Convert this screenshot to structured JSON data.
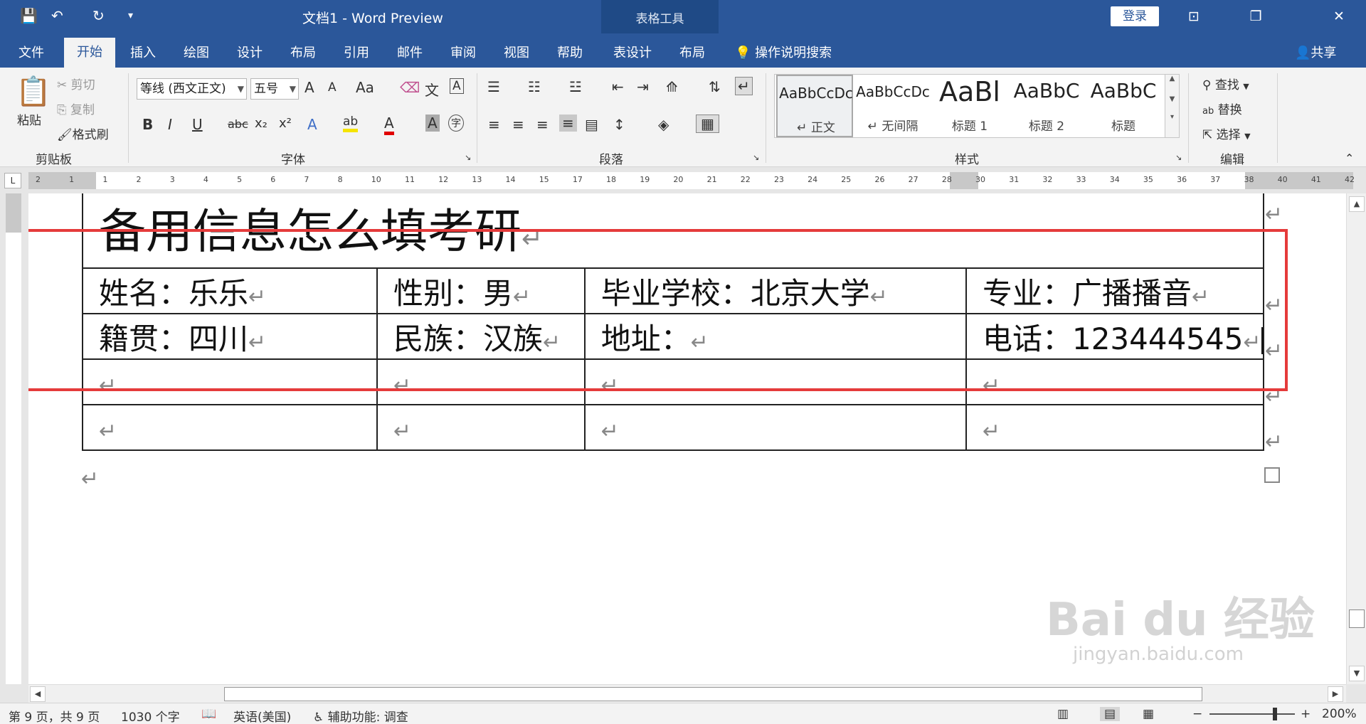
{
  "titlebar": {
    "doc_title": "文档1  -  Word Preview",
    "context_title": "表格工具",
    "login": "登录",
    "qa_save": "💾",
    "qa_undo": "↶",
    "qa_redo": "↻",
    "qa_customize": "▾",
    "btn_restore_ribbon": "⊡",
    "btn_maximize": "❐",
    "btn_close": "✕"
  },
  "tabs": {
    "items": [
      "文件",
      "开始",
      "插入",
      "绘图",
      "设计",
      "布局",
      "引用",
      "邮件",
      "审阅",
      "视图",
      "帮助",
      "表设计",
      "布局"
    ],
    "active": "开始",
    "tell_me": "操作说明搜索",
    "share": "共享"
  },
  "ribbon": {
    "clipboard": {
      "paste": "粘贴",
      "cut": "剪切",
      "copy": "复制",
      "format_painter": "格式刷",
      "label": "剪贴板"
    },
    "font": {
      "font_name": "等线 (西文正文)",
      "font_size": "五号",
      "label": "字体",
      "bold": "B",
      "italic": "I",
      "underline": "U",
      "strike": "abc",
      "subscript": "x₂",
      "superscript": "x²",
      "grow": "A",
      "shrink": "A",
      "change_case": "Aa",
      "phonetic": "文",
      "char_border": "A",
      "effects": "A",
      "highlight": "ab",
      "font_color": "A",
      "char_shade": "A",
      "enclose": "字"
    },
    "paragraph": {
      "label": "段落"
    },
    "styles": {
      "label": "样式",
      "items": [
        {
          "sample": "AaBbCcDc",
          "name": "↵ 正文"
        },
        {
          "sample": "AaBbCcDc",
          "name": "↵ 无间隔"
        },
        {
          "sample": "AaBl",
          "name": "标题 1"
        },
        {
          "sample": "AaBbC",
          "name": "标题 2"
        },
        {
          "sample": "AaBbC",
          "name": "标题"
        }
      ]
    },
    "editing": {
      "label": "编辑",
      "find": "查找",
      "replace": "替换",
      "select": "选择"
    }
  },
  "ruler": {
    "numbers": [
      "2",
      "1",
      "1",
      "2",
      "3",
      "4",
      "5",
      "6",
      "7",
      "8",
      "10",
      "11",
      "12",
      "13",
      "14",
      "15",
      "17",
      "18",
      "19",
      "20",
      "21",
      "22",
      "23",
      "24",
      "25",
      "26",
      "27",
      "28",
      "30",
      "31",
      "32",
      "33",
      "34",
      "35",
      "36",
      "37",
      "38",
      "40",
      "41",
      "42"
    ]
  },
  "document": {
    "title": "备用信息怎么填考研",
    "rows": [
      [
        "姓名：乐乐",
        "性别：男",
        "毕业学校：北京大学",
        "专业：广播播音"
      ],
      [
        "籍贯：四川",
        "民族：汉族",
        "地址：",
        "电话：123444545"
      ],
      [
        "",
        "",
        "",
        ""
      ],
      [
        "",
        "",
        "",
        ""
      ]
    ],
    "mark": "↵"
  },
  "statusbar": {
    "page": "第 9 页，共 9 页",
    "words": "1030 个字",
    "language": "英语(美国)",
    "accessibility": "辅助功能: 调查",
    "zoom": "200%",
    "zoom_fraction": 0.77
  },
  "watermark": {
    "main": "Bai du 经验",
    "sub": "jingyan.baidu.com"
  }
}
